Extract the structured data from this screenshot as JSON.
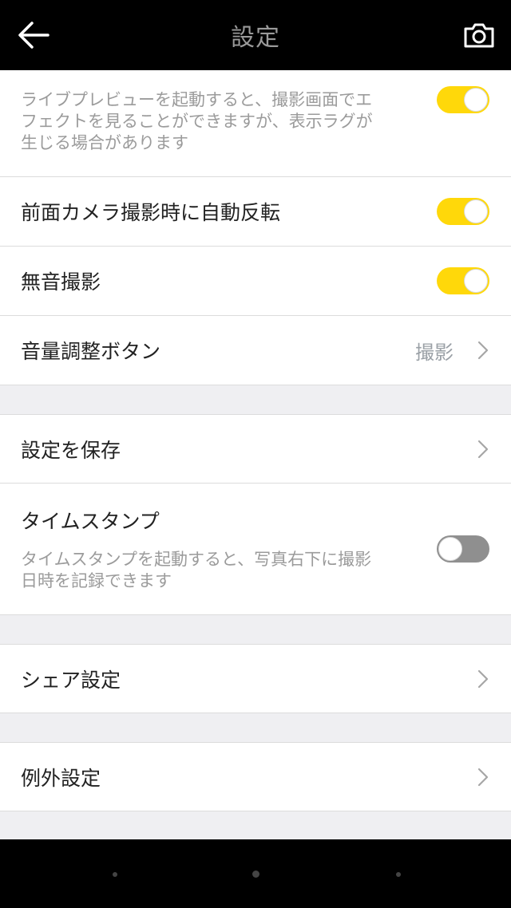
{
  "header": {
    "title": "設定",
    "back_icon": "arrow-left-icon",
    "camera_icon": "camera-icon"
  },
  "settings": {
    "live_preview": {
      "description": "ライブプレビューを起動すると、撮影画面でエフェクトを見ることができますが、表示ラグが生じる場合があります",
      "enabled": true
    },
    "front_mirror": {
      "label": "前面カメラ撮影時に自動反転",
      "enabled": true
    },
    "silent": {
      "label": "無音撮影",
      "enabled": true
    },
    "volume_button": {
      "label": "音量調整ボタン",
      "value": "撮影"
    },
    "save_settings": {
      "label": "設定を保存"
    },
    "timestamp": {
      "label": "タイムスタンプ",
      "description": "タイムスタンプを起動すると、写真右下に撮影日時を記録できます",
      "enabled": false
    },
    "share": {
      "label": "シェア設定"
    },
    "exception": {
      "label": "例外設定"
    }
  },
  "colors": {
    "toggle_on": "#ffd80a",
    "toggle_off": "#8f8f8f",
    "header_bg": "#000000",
    "list_bg": "#efeff2"
  }
}
